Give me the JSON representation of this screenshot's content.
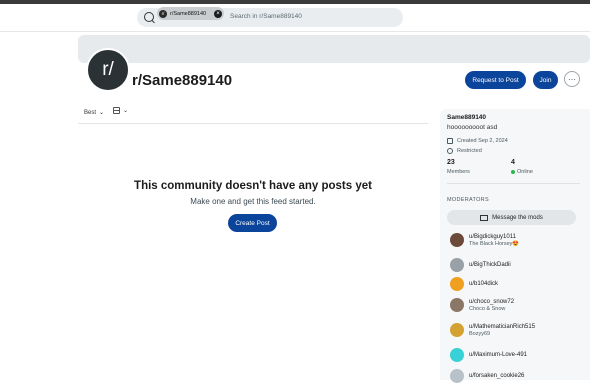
{
  "header": {
    "search": {
      "chip_avatar": "r/",
      "chip_label": "r/Same889140",
      "chip_close": "×",
      "placeholder": "Search in r/Same889140"
    }
  },
  "community": {
    "avatar_text": "r/",
    "title": "r/Same889140",
    "request_button": "Request to Post",
    "join_button": "Join",
    "more_button": "···"
  },
  "feed": {
    "sort_label": "Best",
    "sort_chevron": "⌄",
    "view_chevron": "⌄",
    "empty_title": "This community doesn't have any posts yet",
    "empty_subtitle": "Make one and get this feed started.",
    "create_button": "Create Post"
  },
  "sidebar": {
    "name": "Same889140",
    "description": "hooooooooot asd",
    "created": "Created Sep 2, 2024",
    "restricted": "Restricted",
    "members_count": "23",
    "members_label": "Members",
    "online_count": "4",
    "online_label": "Online",
    "moderators_heading": "MODERATORS",
    "message_button": "Message the mods",
    "moderators": [
      {
        "name": "u/Bigdickguy1011",
        "flair": "The Black Horsey😍",
        "color": "#6b4a3a"
      },
      {
        "name": "u/BigThickDadii",
        "flair": "",
        "color": "#9aa1a6"
      },
      {
        "name": "u/b104dick",
        "flair": "",
        "color": "#f0a020"
      },
      {
        "name": "u/choco_snow72",
        "flair": "Choco & Snow",
        "color": "#8a7766"
      },
      {
        "name": "u/MathematicianRich515",
        "flair": "Bozyy69",
        "color": "#d4a232"
      },
      {
        "name": "u/Maximum-Love-491",
        "flair": "",
        "color": "#39d1d8"
      },
      {
        "name": "u/forsaken_cookie26",
        "flair": "",
        "color": "#b8c2c8"
      }
    ]
  },
  "colors": {
    "primary": "#0a449b",
    "online": "#2db84d"
  }
}
